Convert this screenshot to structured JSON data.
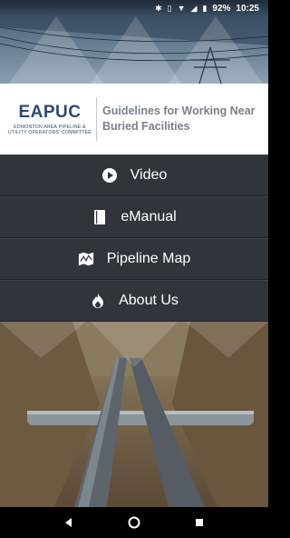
{
  "status_bar": {
    "icons": [
      "bluetooth-icon",
      "vibrate-icon",
      "wifi-icon",
      "signal-icon",
      "battery-icon"
    ],
    "battery": "92%",
    "time": "10:25"
  },
  "brand": {
    "logo_text": "EAPUC",
    "logo_subtitle_line1": "EDMONTON AREA PIPELINE &",
    "logo_subtitle_line2": "UTILITY OPERATORS' COMMITTEE",
    "tagline_line1": "Guidelines for Working Near",
    "tagline_line2": "Buried Facilities",
    "colors": {
      "primary": "#2c4a6e",
      "tagline": "#7a8189",
      "menu_bg": "#30353c"
    }
  },
  "menu": {
    "items": [
      {
        "label": "Video",
        "icon": "play-circle-icon"
      },
      {
        "label": "eManual",
        "icon": "book-icon"
      },
      {
        "label": "Pipeline Map",
        "icon": "map-icon"
      },
      {
        "label": "About Us",
        "icon": "flame-icon"
      }
    ]
  },
  "nav": {
    "buttons": [
      "back-icon",
      "home-icon",
      "recents-icon"
    ]
  }
}
